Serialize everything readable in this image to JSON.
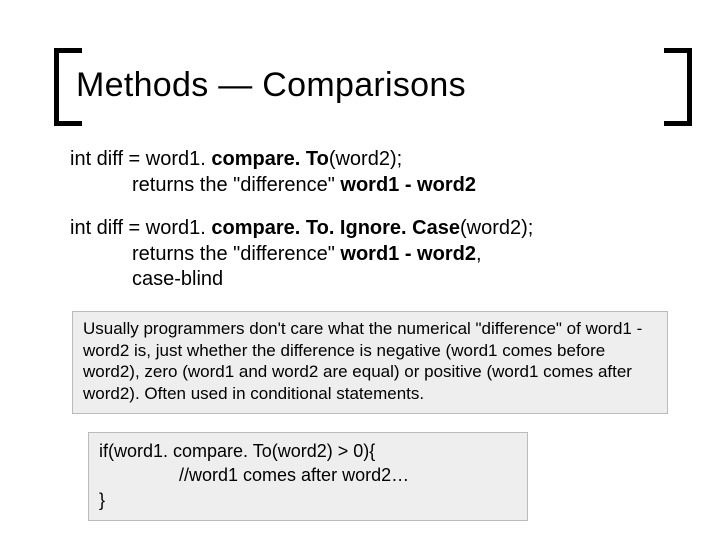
{
  "title": "Methods — Comparisons",
  "block1": {
    "line1_pre": "int diff = word1. ",
    "line1_bold": "compare. To",
    "line1_post": "(word2);",
    "line2_pre": "returns the \"difference\" ",
    "line2_bold": "word1 - word2"
  },
  "block2": {
    "line1_pre": "int diff = word1. ",
    "line1_bold": "compare. To. Ignore. Case",
    "line1_post": "(word2);",
    "line2_pre": "returns the \"difference\" ",
    "line2_bold": "word1 - word2",
    "line2_post": ",",
    "line3": "case-blind"
  },
  "note": "Usually programmers don't care what the numerical \"difference\" of word1 - word2 is, just whether the difference is negative (word1 comes before word2), zero (word1 and word2 are equal) or positive (word1 comes after word2).  Often used in conditional statements.",
  "code": {
    "l1": "if(word1. compare. To(word2) > 0){",
    "l2": "//word1 comes after word2…",
    "l3": "}"
  }
}
